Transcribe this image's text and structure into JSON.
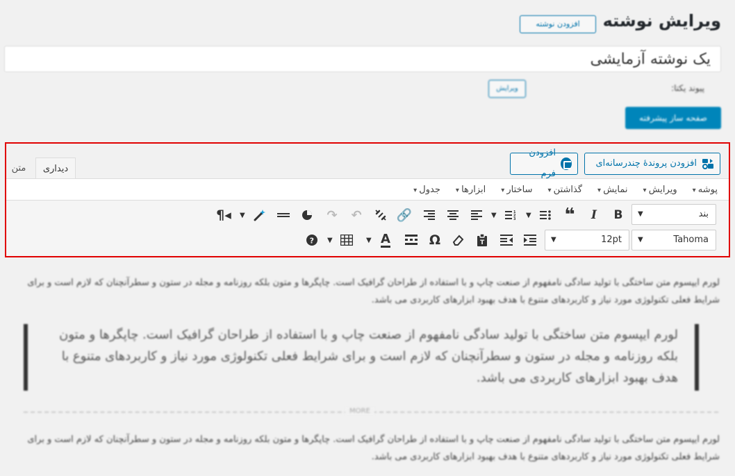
{
  "header": {
    "title": "ویرایش نوشته",
    "add_new": "افزودن نوشته"
  },
  "post": {
    "title": "یک نوشته آزمایشی",
    "permalink_label": "پیوند یکتا:",
    "edit_slug": "ویرایش",
    "page_builder": "صفحه ساز پیشرفته"
  },
  "editor": {
    "media_button": "افزودن پروندهٔ چندرسانه‌ای",
    "form_button": "افزودن فرم",
    "tabs": {
      "visual": "دیداری",
      "text": "متن"
    },
    "menus": [
      "پوشه",
      "ویرایش",
      "نمایش",
      "گذاشتن",
      "ساختار",
      "ابزارها",
      "جدول"
    ],
    "format_select": "بند",
    "font_select": "Tahoma",
    "size_select": "12pt"
  },
  "content": {
    "paragraph1": "لورم ایپسوم متن ساختگی با تولید سادگی نامفهوم از صنعت چاپ و با استفاده از طراحان گرافیک است. چاپگرها و متون بلکه روزنامه و مجله در ستون و سطرآنچنان که لازم است و برای شرایط فعلی تکنولوژی مورد نیاز و کاربردهای متنوع با هدف بهبود ابزارهای کاربردی می باشد.",
    "blockquote": "لورم ایپسوم متن ساختگی با تولید سادگی نامفهوم از صنعت چاپ و با استفاده از طراحان گرافیک است. چاپگرها و متون بلکه روزنامه و مجله در ستون و سطرآنچنان که لازم است و برای شرایط فعلی تکنولوژی مورد نیاز و کاربردهای متنوع با هدف بهبود ابزارهای کاربردی می باشد.",
    "more_label": "MORE",
    "paragraph2": "لورم ایپسوم متن ساختگی با تولید سادگی نامفهوم از صنعت چاپ و با استفاده از طراحان گرافیک است. چاپگرها و متون بلکه روزنامه و مجله در ستون و سطرآنچنان که لازم است و برای شرایط فعلی تکنولوژی مورد نیاز و کاربردهای متنوع با هدف بهبود ابزارهای کاربردی می باشد."
  },
  "colors": {
    "accent": "#0073aa",
    "primary_button": "#0085ba",
    "highlight_border": "#e00000"
  }
}
